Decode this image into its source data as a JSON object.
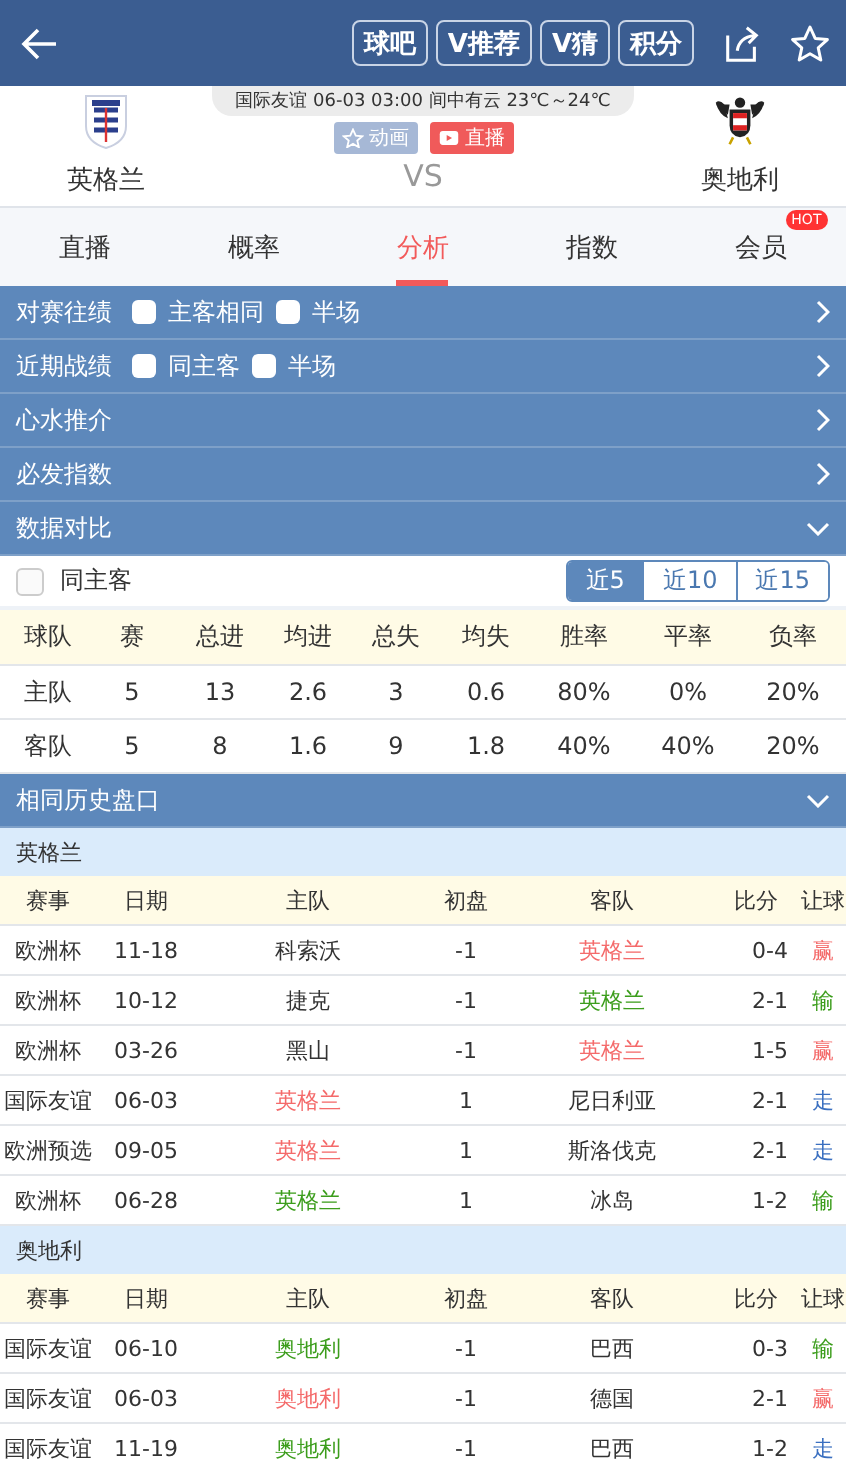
{
  "header": {
    "buttons": [
      "球吧",
      "V推荐",
      "V猜",
      "积分"
    ]
  },
  "match": {
    "info": "国际友谊 06-03 03:00 间中有云 23℃～24℃",
    "home": "英格兰",
    "away": "奥地利",
    "vs": "VS",
    "badges": [
      {
        "kind": "animation",
        "label": "动画"
      },
      {
        "kind": "live",
        "label": "直播"
      }
    ]
  },
  "tabs": [
    {
      "label": "直播",
      "selected": false
    },
    {
      "label": "概率",
      "selected": false
    },
    {
      "label": "分析",
      "selected": true
    },
    {
      "label": "指数",
      "selected": false
    },
    {
      "label": "会员",
      "selected": false,
      "badge": "HOT"
    }
  ],
  "sections": [
    {
      "title": "对赛往绩",
      "expanded": false,
      "options": [
        {
          "label": "主客相同",
          "checked": false
        },
        {
          "label": "半场",
          "checked": false
        }
      ]
    },
    {
      "title": "近期战绩",
      "expanded": false,
      "options": [
        {
          "label": "同主客",
          "checked": false
        },
        {
          "label": "半场",
          "checked": false
        }
      ]
    },
    {
      "title": "心水推介",
      "expanded": false
    },
    {
      "title": "必发指数",
      "expanded": false
    },
    {
      "title": "数据对比",
      "expanded": true
    }
  ],
  "data_compare": {
    "option": {
      "label": "同主客",
      "checked": false
    },
    "ranges": [
      {
        "label": "近5",
        "selected": true
      },
      {
        "label": "近10",
        "selected": false
      },
      {
        "label": "近15",
        "selected": false
      }
    ],
    "columns": [
      "球队",
      "赛",
      "总进",
      "均进",
      "总失",
      "均失",
      "胜率",
      "平率",
      "负率"
    ],
    "rows": [
      [
        "主队",
        "5",
        "13",
        "2.6",
        "3",
        "0.6",
        "80%",
        "0%",
        "20%"
      ],
      [
        "客队",
        "5",
        "8",
        "1.6",
        "9",
        "1.8",
        "40%",
        "40%",
        "20%"
      ]
    ]
  },
  "history": {
    "title": "相同历史盘口",
    "expanded": true,
    "groups": [
      {
        "team": "英格兰",
        "columns": [
          "赛事",
          "日期",
          "主队",
          "初盘",
          "客队",
          "比分",
          "让球"
        ],
        "rows": [
          {
            "event": "欧洲杯",
            "date": "11-18",
            "home": {
              "text": "科索沃"
            },
            "line": "-1",
            "away": {
              "text": "英格兰",
              "color": "#f46a6a"
            },
            "score": "0-4",
            "result": {
              "text": "赢",
              "color": "#f46a6a"
            }
          },
          {
            "event": "欧洲杯",
            "date": "10-12",
            "home": {
              "text": "捷克"
            },
            "line": "-1",
            "away": {
              "text": "英格兰",
              "color": "#3c9d1c"
            },
            "score": "2-1",
            "result": {
              "text": "输",
              "color": "#3c9d1c"
            }
          },
          {
            "event": "欧洲杯",
            "date": "03-26",
            "home": {
              "text": "黑山"
            },
            "line": "-1",
            "away": {
              "text": "英格兰",
              "color": "#f46a6a"
            },
            "score": "1-5",
            "result": {
              "text": "赢",
              "color": "#f46a6a"
            }
          },
          {
            "event": "国际友谊",
            "date": "06-03",
            "home": {
              "text": "英格兰",
              "color": "#f46a6a"
            },
            "line": "1",
            "away": {
              "text": "尼日利亚"
            },
            "score": "2-1",
            "result": {
              "text": "走",
              "color": "#3a6fc0"
            }
          },
          {
            "event": "欧洲预选",
            "date": "09-05",
            "home": {
              "text": "英格兰",
              "color": "#f46a6a"
            },
            "line": "1",
            "away": {
              "text": "斯洛伐克"
            },
            "score": "2-1",
            "result": {
              "text": "走",
              "color": "#3a6fc0"
            }
          },
          {
            "event": "欧洲杯",
            "date": "06-28",
            "home": {
              "text": "英格兰",
              "color": "#3c9d1c"
            },
            "line": "1",
            "away": {
              "text": "冰岛"
            },
            "score": "1-2",
            "result": {
              "text": "输",
              "color": "#3c9d1c"
            }
          }
        ]
      },
      {
        "team": "奥地利",
        "columns": [
          "赛事",
          "日期",
          "主队",
          "初盘",
          "客队",
          "比分",
          "让球"
        ],
        "rows": [
          {
            "event": "国际友谊",
            "date": "06-10",
            "home": {
              "text": "奥地利",
              "color": "#3c9d1c"
            },
            "line": "-1",
            "away": {
              "text": "巴西"
            },
            "score": "0-3",
            "result": {
              "text": "输",
              "color": "#3c9d1c"
            }
          },
          {
            "event": "国际友谊",
            "date": "06-03",
            "home": {
              "text": "奥地利",
              "color": "#f46a6a"
            },
            "line": "-1",
            "away": {
              "text": "德国"
            },
            "score": "2-1",
            "result": {
              "text": "赢",
              "color": "#f46a6a"
            }
          },
          {
            "event": "国际友谊",
            "date": "11-19",
            "home": {
              "text": "奥地利",
              "color": "#3c9d1c"
            },
            "line": "-1",
            "away": {
              "text": "巴西"
            },
            "score": "1-2",
            "result": {
              "text": "走",
              "color": "#3a6fc0"
            }
          }
        ]
      }
    ]
  }
}
